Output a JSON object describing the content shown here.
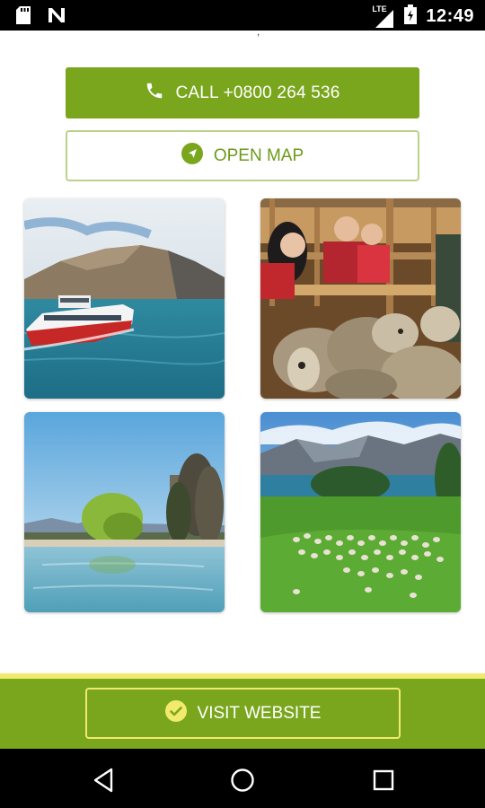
{
  "status_bar": {
    "time": "12:49",
    "network": "LTE",
    "icons": [
      "sd-card-icon",
      "n-notification-icon",
      "signal-icon",
      "battery-icon"
    ]
  },
  "content": {
    "cut_text": ","
  },
  "actions": {
    "call_label": "CALL +0800 264 536",
    "map_label": "OPEN MAP",
    "website_label": "VISIT WEBSITE"
  },
  "gallery": {
    "images": [
      {
        "name": "ferry-boat-lake-photo"
      },
      {
        "name": "sheep-farm-visitors-photo"
      },
      {
        "name": "lakeshore-trees-photo"
      },
      {
        "name": "sheep-flock-meadow-photo"
      }
    ]
  },
  "colors": {
    "brand_green": "#7aa61e",
    "accent_yellow": "#f2ea6c",
    "map_border": "#b9d28a"
  },
  "nav": {
    "icons": [
      "back-icon",
      "home-icon",
      "recents-icon"
    ]
  }
}
